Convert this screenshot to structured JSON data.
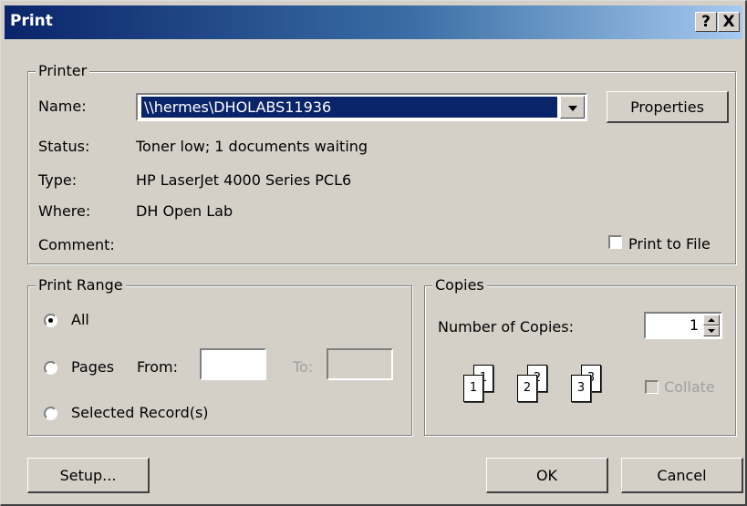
{
  "window": {
    "title": "Print",
    "help_label": "?",
    "close_label": "X"
  },
  "printer": {
    "group_label": "Printer",
    "name_label": "Name:",
    "name_value": "\\\\hermes\\DHOLABS11936",
    "properties_label": "Properties",
    "status_label": "Status:",
    "status_value": "Toner low; 1 documents waiting",
    "type_label": "Type:",
    "type_value": "HP LaserJet 4000 Series PCL6",
    "where_label": "Where:",
    "where_value": "DH Open Lab",
    "comment_label": "Comment:",
    "print_to_file_label": "Print to File",
    "print_to_file_checked": false
  },
  "print_range": {
    "group_label": "Print Range",
    "all_label": "All",
    "pages_label": "Pages",
    "from_label": "From:",
    "to_label": "To:",
    "selected_label": "Selected Record(s)",
    "selected_option": "All"
  },
  "copies": {
    "group_label": "Copies",
    "number_label": "Number of Copies:",
    "number_value": "1",
    "collate_label": "Collate",
    "collate_checked": false,
    "pages": [
      "1",
      "1",
      "2",
      "2",
      "3",
      "3"
    ]
  },
  "buttons": {
    "setup": "Setup...",
    "ok": "OK",
    "cancel": "Cancel"
  },
  "colors": {
    "dialog_bg": "#d4d0c8",
    "title_start": "#0a246a",
    "title_end": "#a6caf0",
    "selection": "#0a246a"
  },
  "icons": [
    "help-icon",
    "close-icon",
    "dropdown-arrow-icon",
    "spin-up-icon",
    "spin-down-icon",
    "collate-pages-icon"
  ]
}
